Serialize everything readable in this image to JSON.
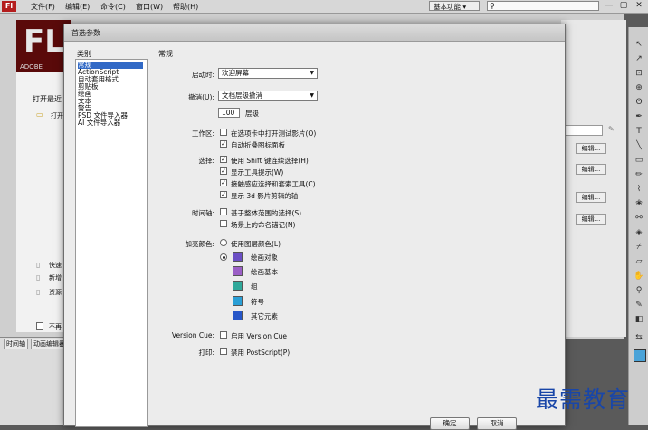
{
  "app": {
    "logo": "Fl",
    "menus": [
      "文件(F)",
      "编辑(E)",
      "命令(C)",
      "窗口(W)",
      "帮助(H)"
    ],
    "workspace": "基本功能 ▾",
    "win_controls": [
      "—",
      "▢",
      "✕"
    ]
  },
  "welcome": {
    "hero": "FL",
    "adobe": "ADOBE",
    "open_recent": "打开最近",
    "open_label": "打开",
    "bottom_labels": [
      "快速",
      "新增",
      "资源"
    ],
    "no_show": "不再"
  },
  "bottom_tabs": [
    "时间轴",
    "动画编辑器"
  ],
  "right_edit_buttons": [
    "编辑...",
    "编辑...",
    "编辑...",
    "编辑..."
  ],
  "dialog": {
    "title": "首选参数",
    "category_label": "类别",
    "categories": [
      "常规",
      "ActionScript",
      "自动套用格式",
      "剪贴板",
      "绘画",
      "文本",
      "警告",
      "PSD 文件导入器",
      "AI 文件导入器"
    ],
    "section_title": "常规",
    "startup": {
      "label": "启动时:",
      "value": "欢迎屏幕"
    },
    "undo": {
      "label": "撤消(U):",
      "value": "文档层级撤消",
      "levels_value": "100",
      "levels_label": "层级"
    },
    "workspace": {
      "label": "工作区:",
      "options": [
        {
          "text": "在选项卡中打开测试影片(O)",
          "checked": false
        },
        {
          "text": "自动折叠图标面板",
          "checked": true
        }
      ]
    },
    "selection": {
      "label": "选择:",
      "options": [
        {
          "text": "使用 Shift 键连续选择(H)",
          "checked": true
        },
        {
          "text": "显示工具提示(W)",
          "checked": true
        },
        {
          "text": "接触感应选择和套索工具(C)",
          "checked": true
        },
        {
          "text": "显示 3d 影片剪辑的轴",
          "checked": true
        }
      ]
    },
    "timeline": {
      "label": "时间轴:",
      "options": [
        {
          "text": "基于整体范围的选择(S)",
          "checked": false
        },
        {
          "text": "场景上的命名锚记(N)",
          "checked": false
        }
      ]
    },
    "highlight": {
      "label": "加亮颜色:",
      "layer_color_option": "使用图层颜色(L)",
      "items": [
        {
          "text": "绘画对象",
          "color": "#6b4fc4"
        },
        {
          "text": "绘画基本",
          "color": "#9b5fc6"
        },
        {
          "text": "组",
          "color": "#2fa89a"
        },
        {
          "text": "符号",
          "color": "#2a9fd6"
        },
        {
          "text": "其它元素",
          "color": "#2656c8"
        }
      ]
    },
    "version_cue": {
      "label": "Version Cue:",
      "text": "启用 Version Cue",
      "checked": false
    },
    "print": {
      "label": "打印:",
      "text": "禁用 PostScript(P)",
      "checked": false
    },
    "buttons": {
      "ok": "确定",
      "cancel": "取消"
    }
  },
  "watermark": "最需教育"
}
